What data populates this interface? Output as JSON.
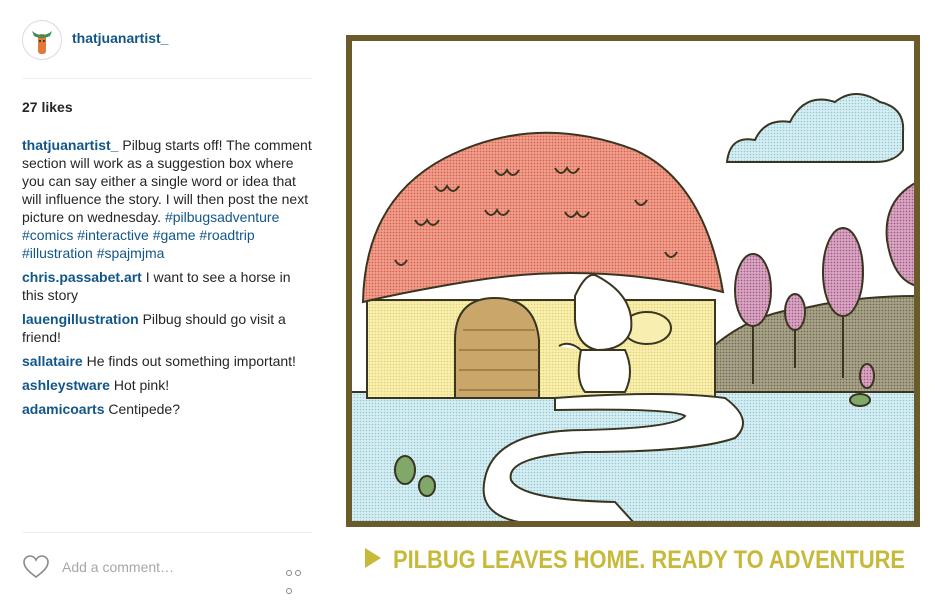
{
  "post": {
    "username": "thatjuanartist_",
    "likes": "27 likes"
  },
  "comments": [
    {
      "user": "thatjuanartist_",
      "text": "Pilbug starts off! The comment section will work as a suggestion box where you can say either a single word or idea that will influence the story. I will then post the next picture on wednesday.",
      "tags": "#pilbugsadventure #comics #interactive #game #roadtrip #illustration #spajmjma"
    },
    {
      "user": "chris.passabet.art",
      "text": "I want to see a horse in this story"
    },
    {
      "user": "lauengillustration",
      "text": "Pilbug should go visit a friend!"
    },
    {
      "user": "sallataire",
      "text": "He finds out something important!"
    },
    {
      "user": "ashleystware",
      "text": "Hot pink!"
    },
    {
      "user": "adamicoarts",
      "text": "Centipede?"
    }
  ],
  "footer": {
    "comment_placeholder": "Add a comment…"
  },
  "photo": {
    "caption": "PILBUG LEAVES HOME. READY TO ADVENTURE"
  },
  "colors": {
    "link": "#125688",
    "roof": "#e07060",
    "wall": "#f2e79a",
    "ground": "#bde3ea",
    "frame": "#6b5a2a",
    "caption": "#c7b93a"
  },
  "icons": [
    "avatar-icon",
    "heart-icon",
    "more-options-icon",
    "play-triangle-icon"
  ]
}
